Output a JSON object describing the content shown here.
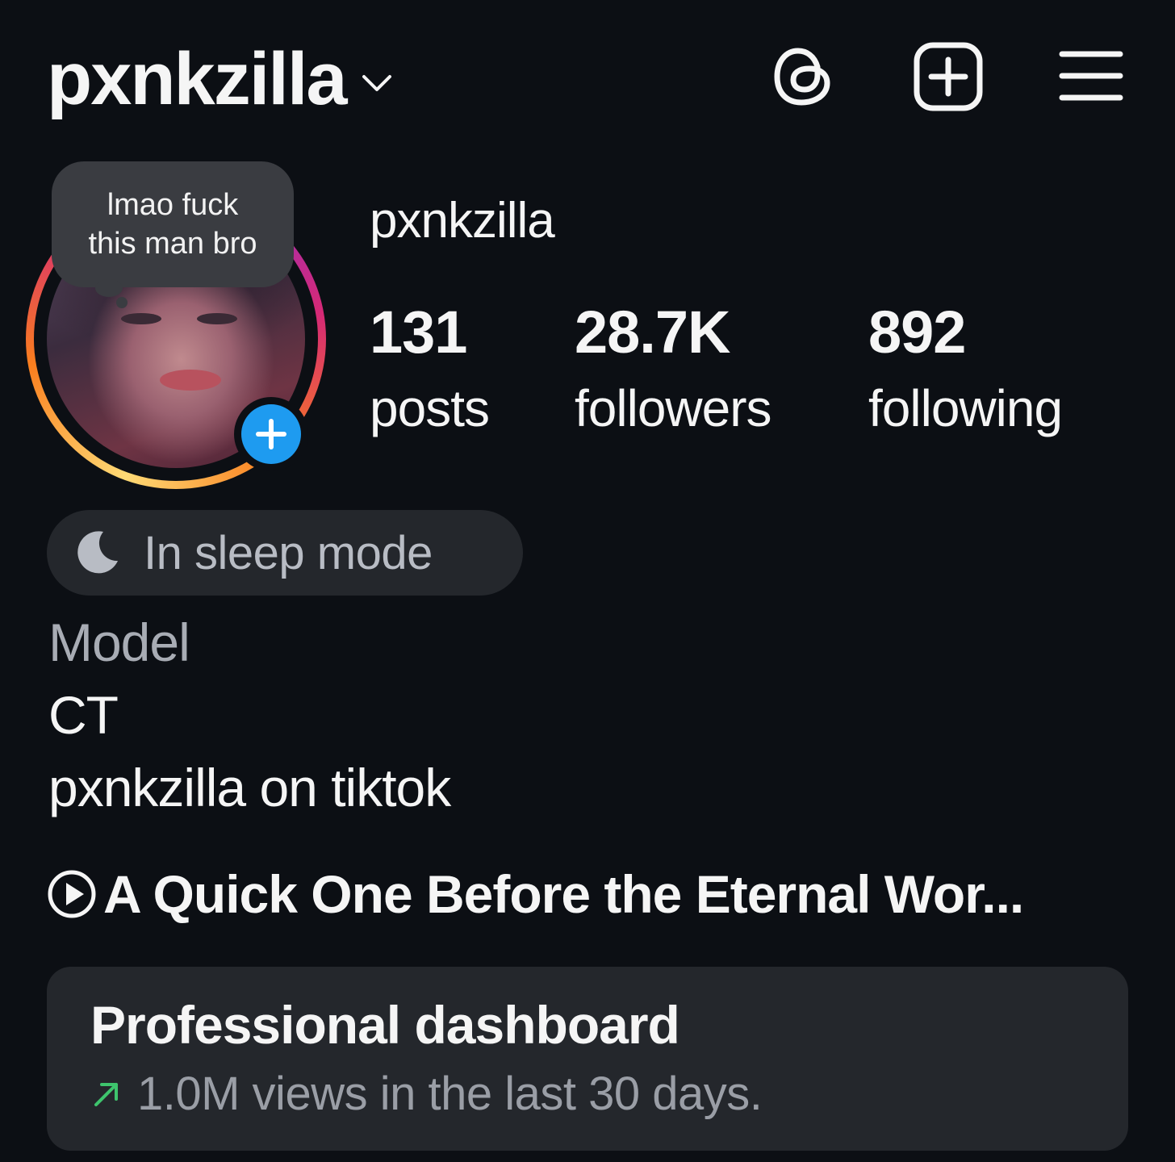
{
  "header": {
    "username": "pxnkzilla",
    "icons": [
      "chevron-down-icon",
      "threads-icon",
      "new-post-icon",
      "menu-icon"
    ]
  },
  "note": {
    "line1": "lmao fuck",
    "line2": "this man bro"
  },
  "profile": {
    "name": "pxnkzilla",
    "stats": [
      {
        "value": "131",
        "label": "posts"
      },
      {
        "value": "28.7K",
        "label": "followers"
      },
      {
        "value": "892",
        "label": "following"
      }
    ]
  },
  "status": {
    "label": "In sleep mode",
    "icon": "moon-icon"
  },
  "bio": {
    "category": "Model",
    "lines": [
      "CT",
      "pxnkzilla on tiktok"
    ]
  },
  "music": {
    "icon": "play-circle-icon",
    "title": "A Quick One Before the Eternal Wor..."
  },
  "dashboard": {
    "title": "Professional dashboard",
    "subtitle": "1.0M views in the last 30 days.",
    "trend_icon": "trend-up-arrow-icon",
    "trend_color": "#3ec46d"
  },
  "colors": {
    "background": "#0c0f14",
    "accent_blue": "#1e9bf0",
    "card": "#24272c"
  }
}
